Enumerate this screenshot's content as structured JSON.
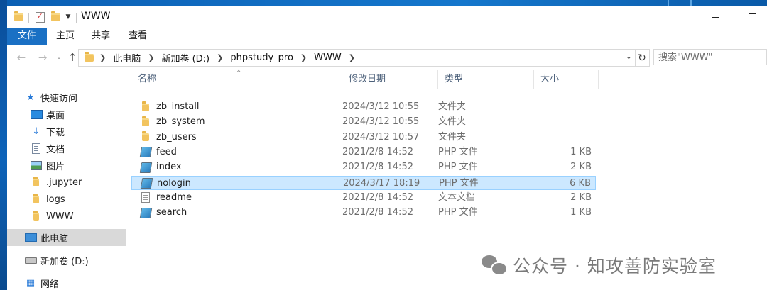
{
  "window": {
    "title": "WWW"
  },
  "ribbon": {
    "tabs": [
      "文件",
      "主页",
      "共享",
      "查看"
    ]
  },
  "address": {
    "crumbs": [
      "此电脑",
      "新加卷 (D:)",
      "phpstudy_pro",
      "WWW"
    ],
    "search_placeholder": "搜索\"WWW\""
  },
  "nav_pane": {
    "quick_access": "快速访问",
    "items": [
      {
        "label": "桌面",
        "icon": "desktop-icon",
        "pinned": true
      },
      {
        "label": "下载",
        "icon": "download-icon",
        "pinned": true
      },
      {
        "label": "文档",
        "icon": "document-icon",
        "pinned": true
      },
      {
        "label": "图片",
        "icon": "picture-icon",
        "pinned": true
      },
      {
        "label": ".jupyter",
        "icon": "folder-icon",
        "pinned": false
      },
      {
        "label": "logs",
        "icon": "folder-icon",
        "pinned": false
      },
      {
        "label": "WWW",
        "icon": "folder-icon",
        "pinned": false
      }
    ],
    "this_pc": "此电脑",
    "drive": "新加卷 (D:)",
    "network": "网络"
  },
  "columns": {
    "name": "名称",
    "modified": "修改日期",
    "type": "类型",
    "size": "大小"
  },
  "files": [
    {
      "name": "zb_install",
      "modified": "2024/3/12 10:55",
      "type": "文件夹",
      "size": "",
      "icon": "folder-icon",
      "selected": false
    },
    {
      "name": "zb_system",
      "modified": "2024/3/12 10:55",
      "type": "文件夹",
      "size": "",
      "icon": "folder-icon",
      "selected": false
    },
    {
      "name": "zb_users",
      "modified": "2024/3/12 10:57",
      "type": "文件夹",
      "size": "",
      "icon": "folder-icon",
      "selected": false
    },
    {
      "name": "feed",
      "modified": "2021/2/8 14:52",
      "type": "PHP 文件",
      "size": "1 KB",
      "icon": "php-file-icon",
      "selected": false
    },
    {
      "name": "index",
      "modified": "2021/2/8 14:52",
      "type": "PHP 文件",
      "size": "2 KB",
      "icon": "php-file-icon",
      "selected": false
    },
    {
      "name": "nologin",
      "modified": "2024/3/17 18:19",
      "type": "PHP 文件",
      "size": "6 KB",
      "icon": "php-file-icon",
      "selected": true
    },
    {
      "name": "readme",
      "modified": "2021/2/8 14:52",
      "type": "文本文档",
      "size": "2 KB",
      "icon": "text-file-icon",
      "selected": false
    },
    {
      "name": "search",
      "modified": "2021/2/8 14:52",
      "type": "PHP 文件",
      "size": "1 KB",
      "icon": "php-file-icon",
      "selected": false
    }
  ],
  "watermark": {
    "text": "公众号 · 知攻善防实验室"
  },
  "colors": {
    "accent": "#1a70c4",
    "selection": "#cce8ff",
    "folder": "#f2c45f"
  }
}
